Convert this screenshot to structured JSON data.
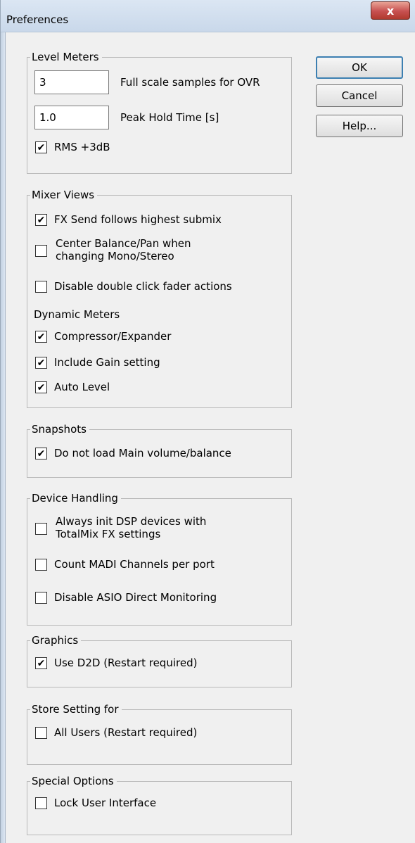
{
  "window": {
    "title": "Preferences",
    "close_glyph": "x"
  },
  "buttons": {
    "ok": "OK",
    "cancel": "Cancel",
    "help": "Help..."
  },
  "level_meters": {
    "legend": "Level Meters",
    "ovr_samples_value": "3",
    "ovr_samples_label": "Full scale samples for OVR",
    "peak_hold_value": "1.0",
    "peak_hold_label": "Peak Hold Time [s]",
    "rms_label": "RMS +3dB",
    "rms_checked": true
  },
  "mixer_views": {
    "legend": "Mixer Views",
    "fx_send_label": "FX Send follows highest submix",
    "fx_send_checked": true,
    "center_balance_label": "Center Balance/Pan when changing Mono/Stereo",
    "center_balance_checked": false,
    "disable_dblclick_label": "Disable double click fader actions",
    "disable_dblclick_checked": false,
    "dynamic_meters_heading": "Dynamic Meters",
    "compressor_label": "Compressor/Expander",
    "compressor_checked": true,
    "include_gain_label": "Include Gain setting",
    "include_gain_checked": true,
    "auto_level_label": "Auto Level",
    "auto_level_checked": true
  },
  "snapshots": {
    "legend": "Snapshots",
    "no_main_volume_label": "Do not load Main volume/balance",
    "no_main_volume_checked": true
  },
  "device_handling": {
    "legend": "Device Handling",
    "init_dsp_label": "Always init DSP devices with TotalMix FX settings",
    "init_dsp_checked": false,
    "count_madi_label": "Count MADI Channels per port",
    "count_madi_checked": false,
    "disable_asio_label": "Disable ASIO Direct Monitoring",
    "disable_asio_checked": false
  },
  "graphics": {
    "legend": "Graphics",
    "use_d2d_label": "Use D2D (Restart required)",
    "use_d2d_checked": true
  },
  "store_setting": {
    "legend": "Store Setting for",
    "all_users_label": "All Users (Restart required)",
    "all_users_checked": false
  },
  "special_options": {
    "legend": "Special Options",
    "lock_ui_label": "Lock User Interface",
    "lock_ui_checked": false
  },
  "icons": {
    "check": "check-mark-icon",
    "close": "close-icon"
  },
  "colors": {
    "title_bar": "#c9d8ea",
    "close_button": "#c75050",
    "default_button_border": "#3c7fb1"
  }
}
